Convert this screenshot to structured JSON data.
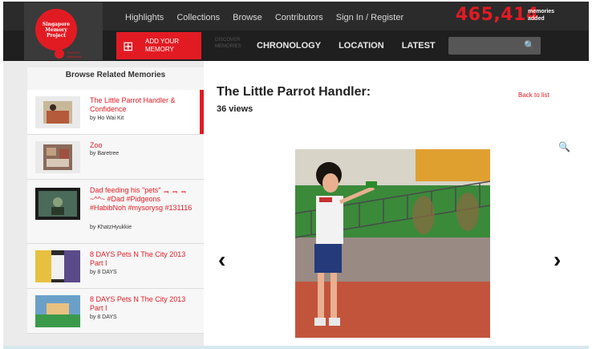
{
  "header": {
    "logo_text": "Singapore Memory Project",
    "logo_sub": "Find Pet Memories",
    "links": [
      "Highlights",
      "Collections",
      "Browse",
      "Contributors",
      "Sign In / Register"
    ],
    "counter": "465,414",
    "counter_label_1": "memories",
    "counter_label_2": "added"
  },
  "nav": {
    "add_line1": "ADD YOUR",
    "add_line2": "MEMORY",
    "discover_1": "DISCOVER",
    "discover_2": "MEMORIES",
    "items": [
      "CHRONOLOGY",
      "LOCATION",
      "LATEST"
    ],
    "search_placeholder": ""
  },
  "sidebar": {
    "header": "Browse Related Memories",
    "items": [
      {
        "title": "The Little Parrot Handler & Confidence",
        "by": "by Ho Wai Kit",
        "active": true
      },
      {
        "title": "Zoo",
        "by": "by Baretree",
        "active": false
      },
      {
        "title": "Dad feeding his \"pets\" ᆿ ᆿ ᆿ ~^^~ #Dad #Pidgeons #HabibNoh #mysorysg #131116",
        "by": "by KhatzHyukkie",
        "active": false
      },
      {
        "title": "8 DAYS Pets N The City 2013 Part I",
        "by": "by 8 DAYS",
        "active": false
      },
      {
        "title": "8 DAYS Pets N The City 2013 Part I",
        "by": "by 8 DAYS",
        "active": false
      }
    ]
  },
  "main": {
    "title": "The Little Parrot Handler:",
    "views": "36 views",
    "back_label": "Back to list"
  },
  "colors": {
    "accent": "#e21b23",
    "header_bg": "#2b2b2b",
    "nav_bg": "#1f1f1f"
  },
  "icons": {
    "search": "search-icon",
    "zoom": "zoom-in-icon",
    "prev": "chevron-left-icon",
    "next": "chevron-right-icon",
    "add": "add-memory-icon"
  }
}
